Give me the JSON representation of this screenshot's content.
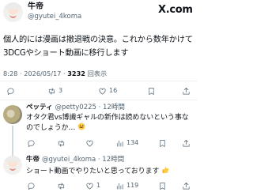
{
  "author": {
    "name": "牛帝",
    "handle": "@gyutei_4koma"
  },
  "brand": {
    "logo_text": "X.com"
  },
  "tweet": {
    "text": "個人的には漫画は撤退戦の決意。これから数年かけて3DCGやショート動画に移行します",
    "time": "8:28 · 2026/05/17 · ",
    "views_count": "3232",
    "views_label": "回表示",
    "actions": {
      "reply": "",
      "retweet": "3",
      "like": "16",
      "bookmark": "",
      "share": ""
    }
  },
  "replies": [
    {
      "name": "ペッティ",
      "handle": "@petty0225 · 12時間",
      "text": "オタク君vs博識ギャルの新作は読めないという事なのでしょうか…",
      "emoji": "sweat-smile-icon",
      "actions": {
        "reply": "",
        "retweet": "",
        "like": "",
        "views": "134",
        "bookmark": "",
        "share": ""
      }
    },
    {
      "name": "牛帝",
      "handle": "@gyutei_4koma · 12時間",
      "text": "ショート動画でやりたいと思っております",
      "emoji": "thumbs-up-icon",
      "actions": {
        "reply": "",
        "retweet": "",
        "like": "1",
        "views": "119",
        "bookmark": "",
        "share": ""
      }
    }
  ],
  "colors": {
    "text": "#0f1419",
    "secondary": "#536471",
    "divider": "#eff3f4",
    "thread": "#cfd9de"
  }
}
